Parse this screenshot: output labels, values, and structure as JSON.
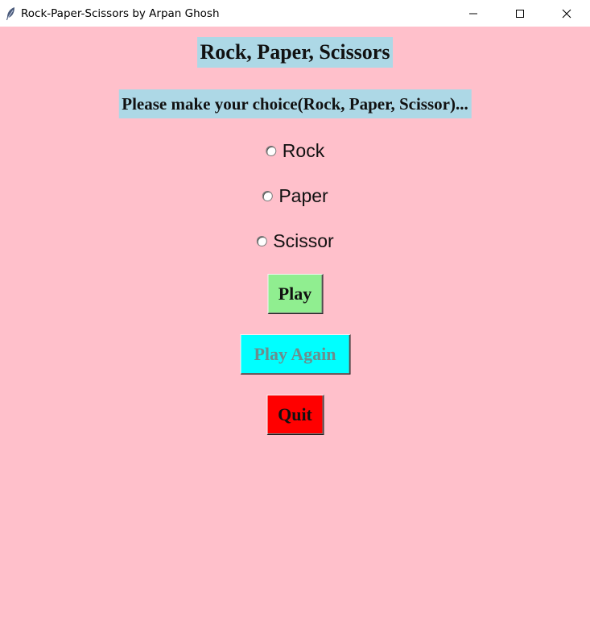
{
  "window": {
    "title": "Rock-Paper-Scissors by Arpan Ghosh",
    "icon": "feather-icon",
    "controls": [
      "minimize-icon",
      "maximize-icon",
      "close-icon"
    ]
  },
  "main": {
    "heading": "Rock, Paper, Scissors",
    "prompt": "Please make your choice(Rock, Paper, Scissor)...",
    "options": [
      {
        "label": "Rock",
        "selected": false
      },
      {
        "label": "Paper",
        "selected": false
      },
      {
        "label": "Scissor",
        "selected": false
      }
    ],
    "buttons": {
      "play": "Play",
      "play_again": "Play Again",
      "quit": "Quit"
    }
  },
  "colors": {
    "background": "#ffc0cb",
    "label_background": "#add8e6",
    "play_button": "#90ee90",
    "play_again_button": "#00ffff",
    "quit_button": "#ff0000"
  }
}
